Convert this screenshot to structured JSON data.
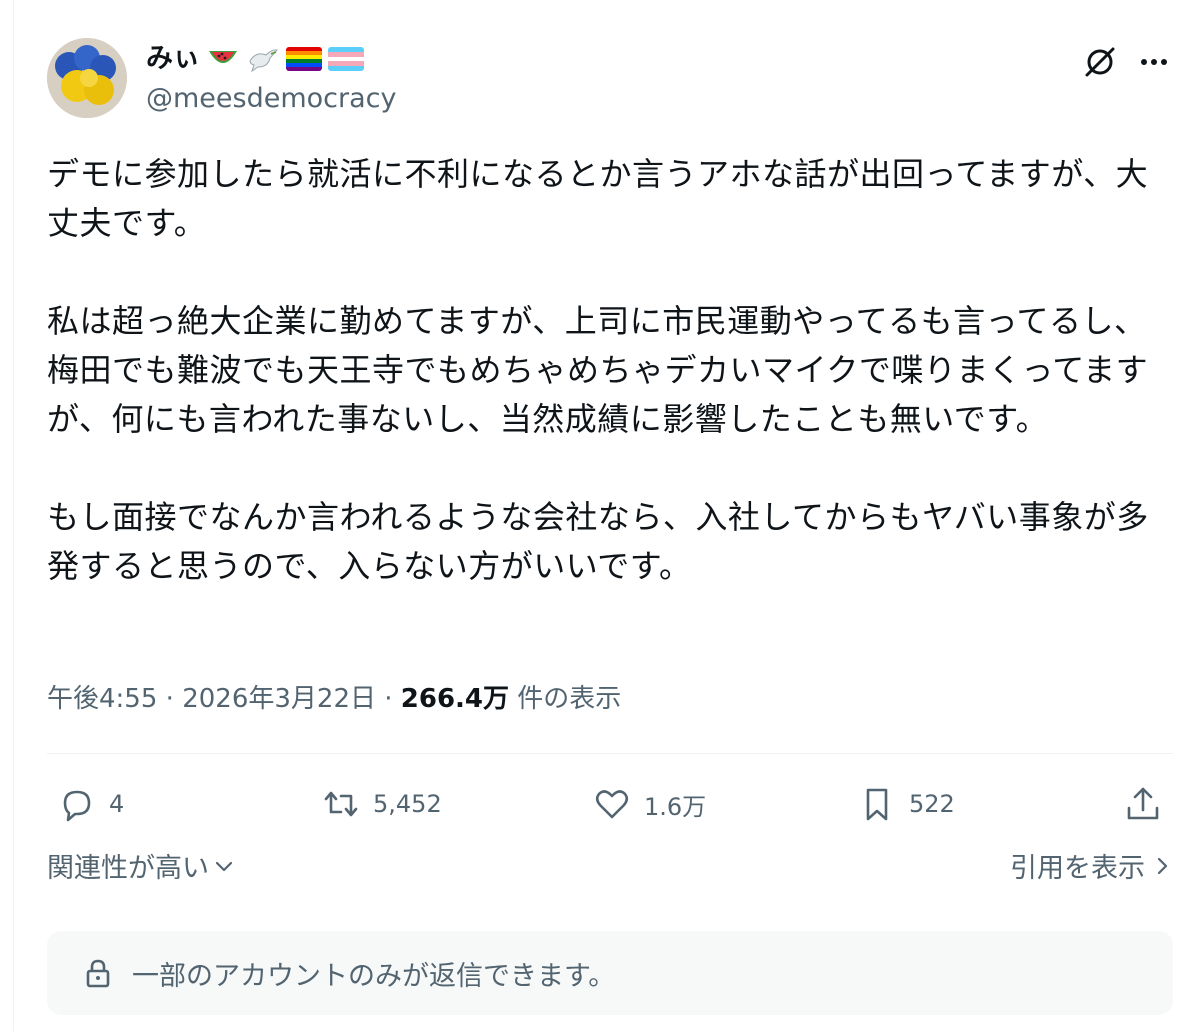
{
  "author": {
    "display_name": "みぃ",
    "handle": "@meesdemocracy",
    "name_emoji": [
      "watermelon-icon",
      "dove-icon",
      "rainbow-flag-icon",
      "transgender-flag-icon"
    ]
  },
  "tweet": {
    "text": "デモに参加したら就活に不利になるとか言うアホな話が出回ってますが、大丈夫です。\n\n私は超っ絶大企業に勤めてますが、上司に市民運動やってるも言ってるし、梅田でも難波でも天王寺でもめちゃめちゃデカいマイクで喋りまくってますが、何にも言われた事ないし、当然成績に影響したことも無いです。\n\nもし面接でなんか言われるような会社なら、入社してからもヤバい事象が多発すると思うので、入らない方がいいです。",
    "time": "午後4:55",
    "date": "2026年3月22日",
    "separator": "·",
    "views_count": "266.4万",
    "views_label": "件の表示"
  },
  "actions": {
    "reply_count": "4",
    "retweet_count": "5,452",
    "like_count": "1.6万",
    "bookmark_count": "522"
  },
  "sort": {
    "label": "関連性が高い"
  },
  "quotes": {
    "label": "引用を表示"
  },
  "reply_restriction": {
    "text": "一部のアカウントのみが返信できます。"
  },
  "colors": {
    "text_primary": "#0f1419",
    "text_secondary": "#536471",
    "divider": "#eff3f4",
    "restriction_bg": "#f7f9f9"
  }
}
